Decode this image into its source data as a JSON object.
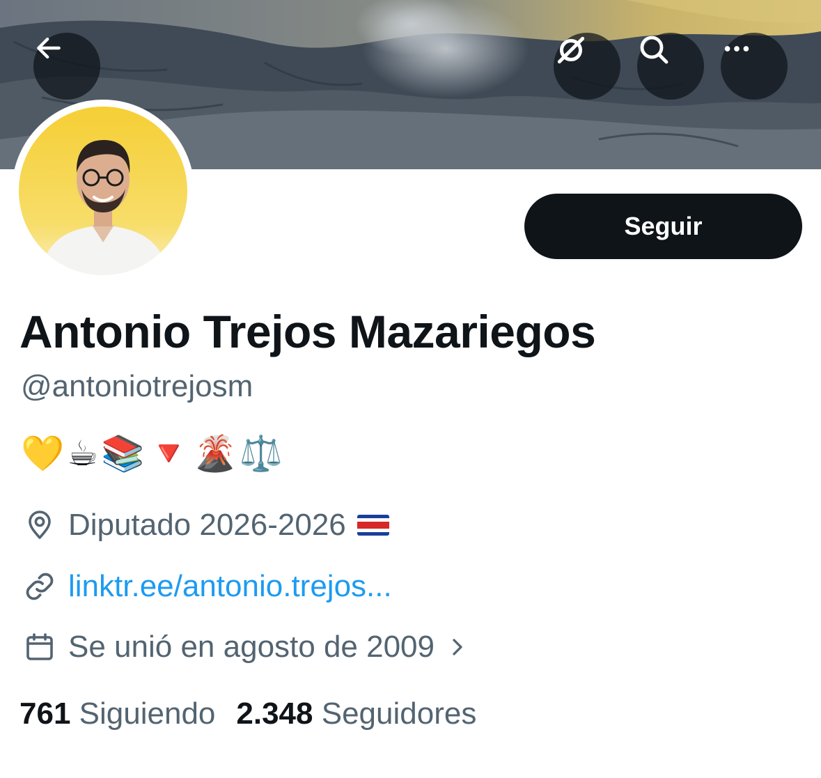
{
  "header": {
    "back_icon": "arrow-left-icon",
    "actions": [
      {
        "icon": "circle-slash-icon"
      },
      {
        "icon": "search-icon"
      },
      {
        "icon": "more-horizontal-icon"
      }
    ]
  },
  "profile": {
    "follow_label": "Seguir",
    "display_name": "Antonio Trejos Mazariegos",
    "handle": "@antoniotrejosm",
    "bio": "💛☕📚🔻🌋⚖️",
    "location": "Diputado 2026-2026",
    "location_flag": "costa-rica-flag",
    "link": "linktr.ee/antonio.trejos...",
    "joined": "Se unió en agosto de 2009"
  },
  "stats": {
    "following_count": "761",
    "following_label": "Siguiendo",
    "followers_count": "2.348",
    "followers_label": "Seguidores"
  },
  "colors": {
    "text": "#0f1419",
    "secondary": "#536471",
    "link": "#1d9bf0",
    "button": "#0f1419",
    "avatar_bg": "#f5cf3c"
  }
}
